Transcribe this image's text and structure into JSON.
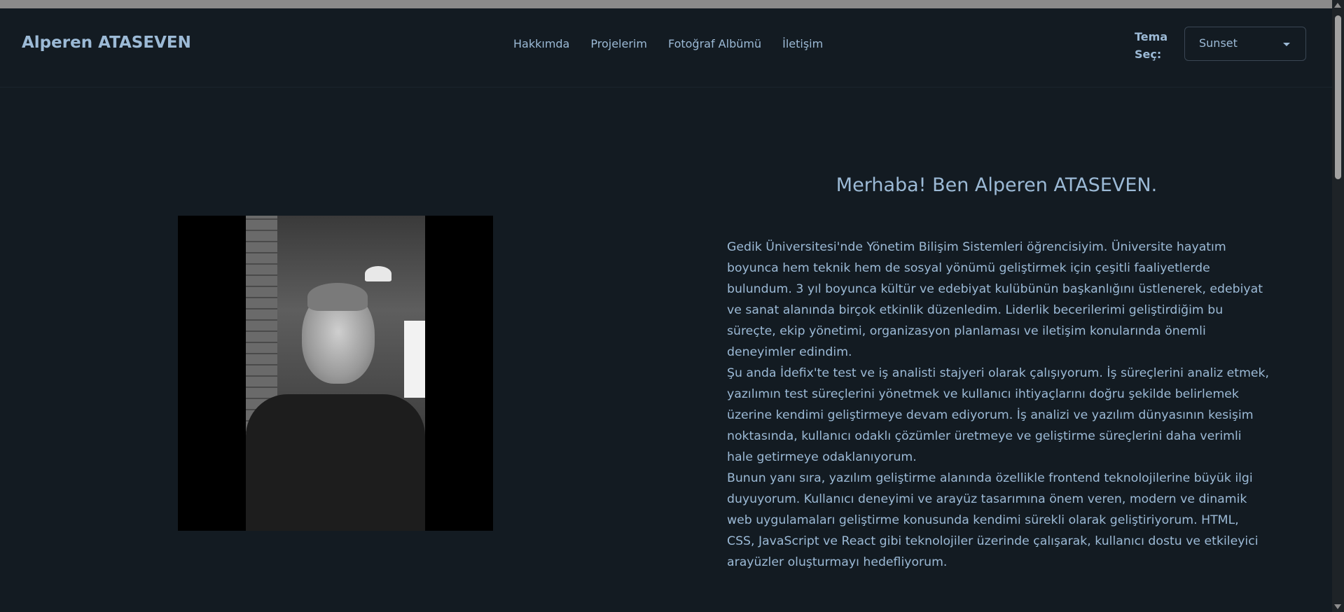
{
  "header": {
    "brand": "Alperen ATASEVEN",
    "nav": [
      "Hakkımda",
      "Projelerim",
      "Fotoğraf Albümü",
      "İletişim"
    ],
    "theme_label": "Tema Seç:",
    "theme_selected": "Sunset"
  },
  "main": {
    "greeting": "Merhaba! Ben Alperen ATASEVEN.",
    "paragraphs": [
      "Gedik Üniversitesi'nde Yönetim Bilişim Sistemleri öğrencisiyim. Üniversite hayatım boyunca hem teknik hem de sosyal yönümü geliştirmek için çeşitli faaliyetlerde bulundum. 3 yıl boyunca kültür ve edebiyat kulübünün başkanlığını üstlenerek, edebiyat ve sanat alanında birçok etkinlik düzenledim. Liderlik becerilerimi geliştirdiğim bu süreçte, ekip yönetimi, organizasyon planlaması ve iletişim konularında önemli deneyimler edindim.",
      "Şu anda İdefix'te test ve iş analisti stajyeri olarak çalışıyorum. İş süreçlerini analiz etmek, yazılımın test süreçlerini yönetmek ve kullanıcı ihtiyaçlarını doğru şekilde belirlemek üzerine kendimi geliştirmeye devam ediyorum. İş analizi ve yazılım dünyasının kesişim noktasında, kullanıcı odaklı çözümler üretmeye ve geliştirme süreçlerini daha verimli hale getirmeye odaklanıyorum.",
      "Bunun yanı sıra, yazılım geliştirme alanında özellikle frontend teknolojilerine büyük ilgi duyuyorum. Kullanıcı deneyimi ve arayüz tasarımına önem veren, modern ve dinamik web uygulamaları geliştirme konusunda kendimi sürekli olarak geliştiriyorum. HTML, CSS, JavaScript ve React gibi teknolojiler üzerinde çalışarak, kullanıcı dostu ve etkileyici arayüzler oluşturmayı hedefliyorum."
    ]
  },
  "colors": {
    "background": "#131b22",
    "text": "#9cbad6"
  }
}
